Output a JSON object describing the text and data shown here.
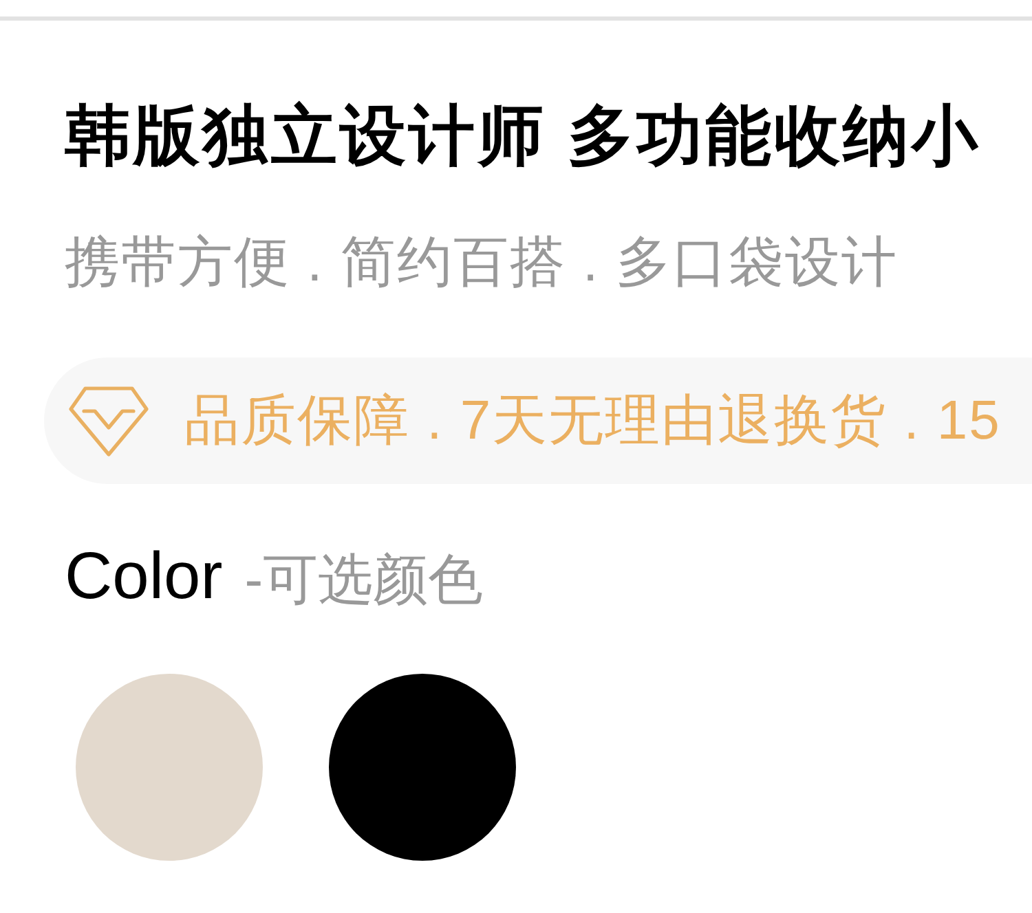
{
  "title": "韩版独立设计师 多功能收纳小",
  "subtitle": "携带方便 . 简约百搭 . 多口袋设计",
  "guarantee_banner": {
    "text": "品质保障 . 7天无理由退换货 . 15"
  },
  "color_section": {
    "label": "Color",
    "hint": "-可选颜色",
    "swatches": [
      {
        "color": "#e3d9cd"
      },
      {
        "color": "#000000"
      }
    ]
  }
}
